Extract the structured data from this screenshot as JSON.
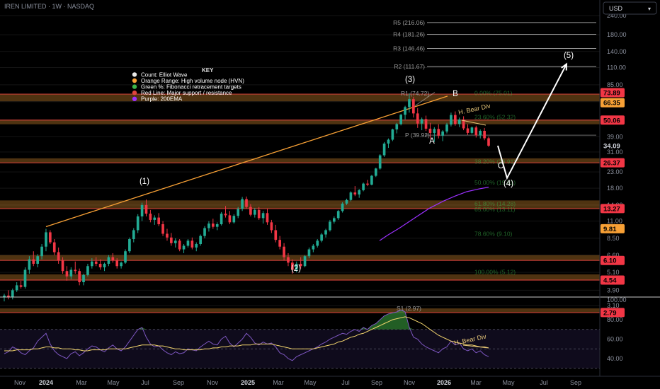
{
  "header": {
    "symbol": "IREN LIMITED · 1W · NASDAQ",
    "currency": "USD"
  },
  "key": {
    "title": "KEY",
    "items": [
      {
        "text": "Count: Elliot Wave",
        "color": "#e8e8e8"
      },
      {
        "text": "Orange Range: High volume node (HVN)",
        "color": "#f7a035"
      },
      {
        "text": "Green %: Fibonacci retracement targets",
        "color": "#3bb34a"
      },
      {
        "text": "Red Line: Major support / resistance",
        "color": "#e0443e"
      },
      {
        "text": "Purple: 200EMA",
        "color": "#9b30ff"
      }
    ]
  },
  "colors": {
    "up": "#22ab94",
    "down": "#f23645",
    "hvn": "#f7a035",
    "fib": "#3bb34a",
    "sr": "#e0443e",
    "ema": "#9b30ff",
    "rsi": "#7e57c2",
    "rsi_ma": "#f5d76e",
    "wave": "#ffffff"
  },
  "chart_data": {
    "type": "candlestick",
    "title": "IREN LIMITED · 1W · NASDAQ",
    "y_scale": "log",
    "y_axis_labels": [
      240,
      180,
      140,
      110,
      85,
      66,
      50,
      39,
      31,
      23,
      18,
      14,
      11,
      8.5,
      6.6,
      5.1,
      3.9,
      3.1
    ],
    "x_axis_labels": [
      "Nov",
      "2024",
      "Mar",
      "May",
      "Jul",
      "Sep",
      "Nov",
      "2025",
      "Mar",
      "May",
      "Jul",
      "Sep",
      "Nov",
      "2026",
      "Mar",
      "May",
      "Jul",
      "Sep"
    ],
    "price_tags": [
      {
        "value": "73.89",
        "bg": "#f23645"
      },
      {
        "value": "66.35",
        "bg": "#f7a035"
      },
      {
        "value": "50.06",
        "bg": "#f23645"
      },
      {
        "value": "34.09",
        "bg": ""
      },
      {
        "value": "26.37",
        "bg": "#f23645"
      },
      {
        "value": "13.27",
        "bg": "#f23645"
      },
      {
        "value": "9.81",
        "bg": "#f7a035"
      },
      {
        "value": "6.10",
        "bg": "#f23645"
      },
      {
        "value": "4.54",
        "bg": "#f23645"
      },
      {
        "value": "2.79",
        "bg": "#f23645"
      }
    ],
    "support_resistance": [
      73.89,
      50.06,
      26.37,
      13.27,
      6.1,
      4.54,
      2.79
    ],
    "hvn_zones": [
      [
        66.35,
        73.89
      ],
      [
        47.0,
        50.06
      ],
      [
        26.37,
        28.2
      ],
      [
        13.27,
        15.0
      ],
      [
        6.1,
        6.6
      ],
      [
        4.54,
        4.95
      ],
      [
        2.79,
        2.97
      ]
    ],
    "pivots": [
      {
        "label": "R5 (216.06)",
        "value": 216.06
      },
      {
        "label": "R4 (181.26)",
        "value": 181.26
      },
      {
        "label": "R3 (146.46)",
        "value": 146.46
      },
      {
        "label": "R2 (111.67)",
        "value": 111.67
      },
      {
        "label": "R1 (74.72)",
        "value": 74.72
      },
      {
        "label": "P (39.92)",
        "value": 39.92
      },
      {
        "label": "S1 (2.97)",
        "value": 2.97
      }
    ],
    "fib_levels": [
      {
        "label": "0.00% (75.01)",
        "value": 75.01
      },
      {
        "label": "23.60% (52.32)",
        "value": 52.32
      },
      {
        "label": "38.20% (26.91)",
        "value": 26.91
      },
      {
        "label": "50.00% (19.61)",
        "value": 19.61
      },
      {
        "label": "61.80% (14.28)",
        "value": 14.28
      },
      {
        "label": "65.00% (13.11)",
        "value": 13.11
      },
      {
        "label": "78.60% (9.10)",
        "value": 9.1
      },
      {
        "label": "100.00% (5.12)",
        "value": 5.12
      }
    ],
    "wave_labels": [
      "(1)",
      "(2)",
      "(3)",
      "A",
      "B",
      "C",
      "(4)",
      "(5)"
    ],
    "annotations": [
      "H. Bear Div",
      "H. Bear Div"
    ],
    "rsi_axis_labels": [
      100,
      80,
      60,
      40
    ],
    "candles_ohlc": [
      [
        3.5,
        3.7,
        3.3,
        3.6
      ],
      [
        3.6,
        3.9,
        3.4,
        3.5
      ],
      [
        3.5,
        4.0,
        3.4,
        3.9
      ],
      [
        3.9,
        4.4,
        3.8,
        4.2
      ],
      [
        4.2,
        4.5,
        4.0,
        4.1
      ],
      [
        4.1,
        5.5,
        4.0,
        5.3
      ],
      [
        5.3,
        6.5,
        5.0,
        6.2
      ],
      [
        6.2,
        7.0,
        5.6,
        5.8
      ],
      [
        5.8,
        6.7,
        5.5,
        6.5
      ],
      [
        6.5,
        7.8,
        6.2,
        7.5
      ],
      [
        7.5,
        9.8,
        7.0,
        9.3
      ],
      [
        9.3,
        9.6,
        7.8,
        8.0
      ],
      [
        8.0,
        8.4,
        6.6,
        6.9
      ],
      [
        6.9,
        7.4,
        5.8,
        6.1
      ],
      [
        6.1,
        6.4,
        5.0,
        5.2
      ],
      [
        5.2,
        5.6,
        4.5,
        4.8
      ],
      [
        4.8,
        5.5,
        4.6,
        5.3
      ],
      [
        5.3,
        6.0,
        5.0,
        5.2
      ],
      [
        5.2,
        5.4,
        4.2,
        4.4
      ],
      [
        4.4,
        5.0,
        4.2,
        4.9
      ],
      [
        4.9,
        5.8,
        4.8,
        5.6
      ],
      [
        5.6,
        6.3,
        5.4,
        6.0
      ],
      [
        6.0,
        6.4,
        5.6,
        5.8
      ],
      [
        5.8,
        6.2,
        5.3,
        5.5
      ],
      [
        5.5,
        5.9,
        5.2,
        5.8
      ],
      [
        5.8,
        6.6,
        5.6,
        6.4
      ],
      [
        6.4,
        6.8,
        5.9,
        6.1
      ],
      [
        6.1,
        6.3,
        5.4,
        5.6
      ],
      [
        5.6,
        6.0,
        5.4,
        5.9
      ],
      [
        5.9,
        7.2,
        5.8,
        7.0
      ],
      [
        7.0,
        8.6,
        6.8,
        8.4
      ],
      [
        8.4,
        9.9,
        8.0,
        9.6
      ],
      [
        9.6,
        12.2,
        9.2,
        11.8
      ],
      [
        11.8,
        14.5,
        11.0,
        14.0
      ],
      [
        14.0,
        15.2,
        11.8,
        12.3
      ],
      [
        12.3,
        13.0,
        10.8,
        11.2
      ],
      [
        11.2,
        12.0,
        10.4,
        11.6
      ],
      [
        11.6,
        12.4,
        10.2,
        10.5
      ],
      [
        10.5,
        11.0,
        8.8,
        9.1
      ],
      [
        9.1,
        9.8,
        8.2,
        8.6
      ],
      [
        8.6,
        9.2,
        7.6,
        7.9
      ],
      [
        7.9,
        8.5,
        7.4,
        8.2
      ],
      [
        8.2,
        8.4,
        7.0,
        7.2
      ],
      [
        7.2,
        7.8,
        6.8,
        7.6
      ],
      [
        7.6,
        8.4,
        7.4,
        8.2
      ],
      [
        8.2,
        8.6,
        7.2,
        7.4
      ],
      [
        7.4,
        8.0,
        7.0,
        7.8
      ],
      [
        7.8,
        9.0,
        7.6,
        8.8
      ],
      [
        8.8,
        10.2,
        8.5,
        9.9
      ],
      [
        9.9,
        11.0,
        9.4,
        10.6
      ],
      [
        10.6,
        11.4,
        9.8,
        10.1
      ],
      [
        10.1,
        10.8,
        9.6,
        10.5
      ],
      [
        10.5,
        12.6,
        10.3,
        12.3
      ],
      [
        12.3,
        13.8,
        11.6,
        12.0
      ],
      [
        12.0,
        12.8,
        10.5,
        10.8
      ],
      [
        10.8,
        12.2,
        10.6,
        11.9
      ],
      [
        11.9,
        13.6,
        11.5,
        13.2
      ],
      [
        13.2,
        15.8,
        12.8,
        15.3
      ],
      [
        15.3,
        15.9,
        13.2,
        13.6
      ],
      [
        13.6,
        14.2,
        11.8,
        12.1
      ],
      [
        12.1,
        13.4,
        11.6,
        13.0
      ],
      [
        13.0,
        13.6,
        11.2,
        11.5
      ],
      [
        11.5,
        12.8,
        10.6,
        12.4
      ],
      [
        12.4,
        13.2,
        10.4,
        10.8
      ],
      [
        10.8,
        11.2,
        9.2,
        9.6
      ],
      [
        9.6,
        10.4,
        8.0,
        8.3
      ],
      [
        8.3,
        8.8,
        7.2,
        7.5
      ],
      [
        7.5,
        7.9,
        6.1,
        6.4
      ],
      [
        6.4,
        6.8,
        5.6,
        5.9
      ],
      [
        5.9,
        6.2,
        5.0,
        5.3
      ],
      [
        5.3,
        6.0,
        5.1,
        5.8
      ],
      [
        5.8,
        6.4,
        5.4,
        5.6
      ],
      [
        5.6,
        6.6,
        5.5,
        6.5
      ],
      [
        6.5,
        7.4,
        6.3,
        7.2
      ],
      [
        7.2,
        7.8,
        6.9,
        7.6
      ],
      [
        7.6,
        8.4,
        7.4,
        8.2
      ],
      [
        8.2,
        9.2,
        8.0,
        9.0
      ],
      [
        9.0,
        9.8,
        8.6,
        9.6
      ],
      [
        9.6,
        11.2,
        9.4,
        10.9
      ],
      [
        10.9,
        11.8,
        10.6,
        11.5
      ],
      [
        11.5,
        13.0,
        11.2,
        12.8
      ],
      [
        12.8,
        14.6,
        12.5,
        14.3
      ],
      [
        14.3,
        15.4,
        14.0,
        15.1
      ],
      [
        15.1,
        17.2,
        14.8,
        16.9
      ],
      [
        16.9,
        18.6,
        16.0,
        16.4
      ],
      [
        16.4,
        17.8,
        15.6,
        17.5
      ],
      [
        17.5,
        19.6,
        17.2,
        19.3
      ],
      [
        19.3,
        20.4,
        18.6,
        19.0
      ],
      [
        19.0,
        22.0,
        18.8,
        21.7
      ],
      [
        21.7,
        24.5,
        21.3,
        24.2
      ],
      [
        24.2,
        30.0,
        23.8,
        29.5
      ],
      [
        29.5,
        36.0,
        28.8,
        35.2
      ],
      [
        35.2,
        38.0,
        33.0,
        37.3
      ],
      [
        37.3,
        44.0,
        36.5,
        43.5
      ],
      [
        43.5,
        48.0,
        41.0,
        47.1
      ],
      [
        47.1,
        55.0,
        46.2,
        54.2
      ],
      [
        54.2,
        62.0,
        50.5,
        60.8
      ],
      [
        60.8,
        74.8,
        56.0,
        68.5
      ],
      [
        68.5,
        71.0,
        52.0,
        55.3
      ],
      [
        55.3,
        60.0,
        44.5,
        47.5
      ],
      [
        47.5,
        52.0,
        43.0,
        50.8
      ],
      [
        50.8,
        53.5,
        42.5,
        44.0
      ],
      [
        44.0,
        48.0,
        37.5,
        41.2
      ],
      [
        41.2,
        45.0,
        36.0,
        43.8
      ],
      [
        43.8,
        47.0,
        38.0,
        39.6
      ],
      [
        39.6,
        43.0,
        36.5,
        42.2
      ],
      [
        42.2,
        48.0,
        41.0,
        46.8
      ],
      [
        46.8,
        56.0,
        45.5,
        54.0
      ],
      [
        54.0,
        57.0,
        46.0,
        47.2
      ],
      [
        47.2,
        52.0,
        45.0,
        50.5
      ],
      [
        50.5,
        53.0,
        43.0,
        44.2
      ],
      [
        44.2,
        47.0,
        40.0,
        41.3
      ],
      [
        41.3,
        45.5,
        40.5,
        44.8
      ],
      [
        44.8,
        46.0,
        38.5,
        39.8
      ],
      [
        39.8,
        43.5,
        38.0,
        42.6
      ],
      [
        42.6,
        44.5,
        37.0,
        38.1
      ],
      [
        38.1,
        39.0,
        33.5,
        34.09
      ]
    ],
    "ema200": [
      [
        0.0,
        8.2
      ],
      [
        0.04,
        8.9
      ],
      [
        0.1,
        9.9
      ],
      [
        0.18,
        11.6
      ],
      [
        0.25,
        13.3
      ],
      [
        0.32,
        14.8
      ],
      [
        0.38,
        16.0
      ],
      [
        0.44,
        17.1
      ],
      [
        0.5,
        17.8
      ],
      [
        0.55,
        18.3
      ]
    ],
    "rsi": [
      45,
      47,
      52,
      50,
      46,
      44,
      48,
      51,
      58,
      62,
      66,
      55,
      48,
      44,
      42,
      40,
      45,
      47,
      43,
      46,
      50,
      53,
      52,
      49,
      47,
      51,
      54,
      50,
      48,
      52,
      58,
      64,
      70,
      72,
      62,
      55,
      52,
      53,
      49,
      46,
      44,
      47,
      45,
      46,
      50,
      49,
      48,
      52,
      55,
      58,
      55,
      54,
      60,
      63,
      56,
      52,
      56,
      60,
      66,
      62,
      56,
      54,
      57,
      55,
      56,
      52,
      46,
      44,
      40,
      38,
      42,
      44,
      46,
      48,
      50,
      52,
      55,
      57,
      60,
      62,
      64,
      66,
      65,
      68,
      70,
      68,
      72,
      70,
      74,
      76,
      80,
      84,
      86,
      87,
      88,
      90,
      88,
      72,
      62,
      60,
      55,
      52,
      50,
      48,
      46,
      50,
      52,
      58,
      54,
      56,
      50,
      48,
      50,
      46,
      48,
      44,
      42
    ],
    "rsi_ma": [
      48,
      48,
      48,
      49,
      49,
      49,
      49,
      50,
      50,
      51,
      52,
      52,
      51,
      51,
      50,
      50,
      50,
      49,
      49,
      48,
      48,
      49,
      49,
      49,
      49,
      50,
      50,
      50,
      50,
      50,
      51,
      52,
      53,
      54,
      54,
      54,
      54,
      53,
      53,
      52,
      51,
      50,
      50,
      49,
      49,
      49,
      49,
      49,
      50,
      50,
      51,
      51,
      52,
      52,
      53,
      53,
      53,
      54,
      54,
      54,
      55,
      55,
      55,
      55,
      55,
      54,
      53,
      52,
      51,
      50,
      50,
      50,
      50,
      50,
      50,
      51,
      52,
      53,
      54,
      55,
      57,
      58,
      60,
      62,
      63,
      65,
      66,
      68,
      70,
      72,
      74,
      76,
      78,
      80,
      81,
      82,
      83,
      82,
      80,
      78,
      76,
      73,
      70,
      67,
      64,
      62,
      60,
      58,
      57,
      56,
      55,
      54,
      54,
      53,
      52,
      52,
      51
    ],
    "projection": [
      [
        34.09,
        0
      ],
      [
        21.0,
        3.5
      ],
      [
        116,
        14.5
      ]
    ]
  }
}
